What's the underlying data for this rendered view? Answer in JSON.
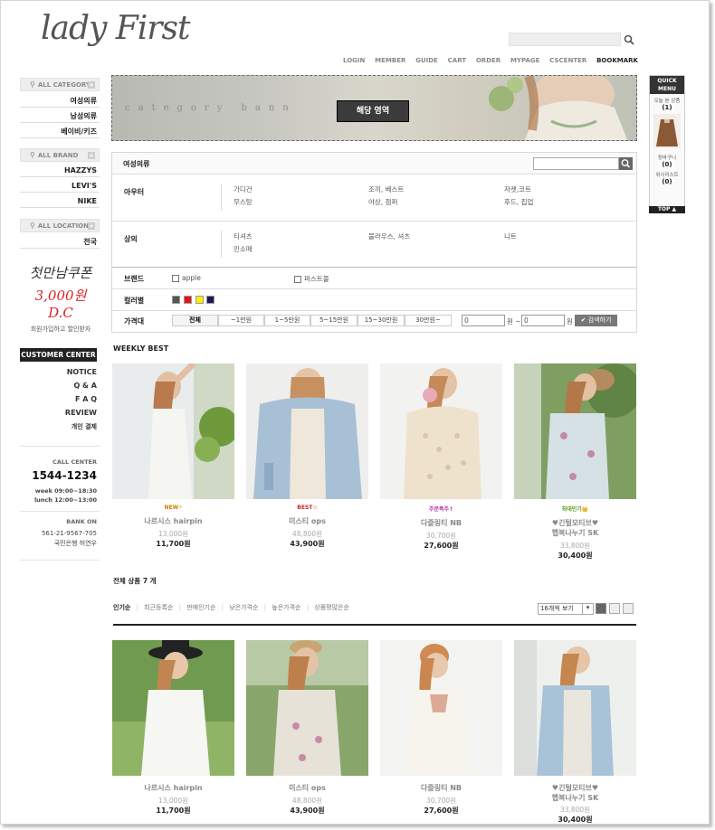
{
  "header": {
    "logo": "lady First",
    "nav": [
      "LOGIN",
      "MEMBER",
      "GUIDE",
      "CART",
      "ORDER",
      "MYPAGE",
      "CSCENTER",
      "BOOKMARK"
    ]
  },
  "sidebar": {
    "category_head": "ALL CATEGORY",
    "categories": [
      "여성의류",
      "남성의류",
      "베이비/키즈"
    ],
    "brand_head": "ALL BRAND",
    "brands": [
      "HAZZYS",
      "LEVI'S",
      "NIKE"
    ],
    "location_head": "ALL LOCATION",
    "locations": [
      "전국"
    ],
    "coupon": {
      "line1": "첫만남쿠폰",
      "line2": "3,000원 D.C",
      "line3": "회원가입하고 할인받자"
    },
    "customer_center": "CUSTOMER CENTER",
    "cs_links": [
      "NOTICE",
      "Q & A",
      "F A Q",
      "REVIEW",
      "개인 결제"
    ],
    "call_center_label": "CALL CENTER",
    "phone": "1544-1234",
    "hours_week": "week 09:00~18:30",
    "hours_lunch": "lunch 12:00~13:00",
    "bank_label": "BANK ON",
    "bank_account": "561-21-9567-705",
    "bank_holder": "국민은행 허연우"
  },
  "banner": {
    "watermark": "category bann",
    "label": "해당 영역"
  },
  "quick_menu": {
    "title_1": "QUICK",
    "title_2": "MENU",
    "recent_label": "오늘 본 상품",
    "recent_count": "(1)",
    "cart_label": "장바구니",
    "cart_count": "(0)",
    "wish_label": "위시리스트",
    "wish_count": "(0)",
    "top": "TOP ▲"
  },
  "filter": {
    "title": "여성의류",
    "outer_label": "아우터",
    "outer_items": [
      "가디건",
      "조끼, 베스트",
      "자켓,코트",
      "무스탕",
      "야상, 점퍼",
      "후드, 집업"
    ],
    "top_label": "상의",
    "top_items": [
      "티셔츠",
      "블라우스, 셔츠",
      "니트",
      "민소매"
    ],
    "brand_label": "브랜드",
    "brand_opts": [
      "apple",
      "퍼스트몰"
    ],
    "color_label": "컬러별",
    "colors": [
      "#555555",
      "#ee1111",
      "#ffee00",
      "#1a1a55"
    ],
    "price_label": "가격대",
    "price_tabs": [
      "전체",
      "~1만원",
      "1~5만원",
      "5~15만원",
      "15~30만원",
      "30만원~"
    ],
    "price_from": "0",
    "price_to": "0",
    "won": "원 ~",
    "won2": "원",
    "search_btn": "✔ 검색하기"
  },
  "weekly_best": {
    "title": "WEEKLY BEST",
    "items": [
      {
        "badge": "NEW⚡",
        "name": "나르시스 hairpin",
        "old": "13,000원",
        "price": "11,700원"
      },
      {
        "badge": "BEST☆",
        "name": "미스티 ops",
        "old": "48,800원",
        "price": "43,900원"
      },
      {
        "badge": "주문폭주↑",
        "name": "다즐링티 NB",
        "old": "30,700원",
        "price": "27,600원"
      },
      {
        "badge": "최대인기👑",
        "name": "♥긴털모티브♥",
        "name2": "햅복나누기 SK",
        "old": "33,800원",
        "price": "30,400원"
      }
    ]
  },
  "list": {
    "total": "전체 상품 7 개",
    "sorts": [
      "인기순",
      "최근등록순",
      "판매인기순",
      "낮은가격순",
      "높은가격순",
      "상품평많은순"
    ],
    "per_page": "16개씩 보기",
    "items": [
      {
        "name": "나르시스 hairpin",
        "old": "13,000원",
        "price": "11,700원"
      },
      {
        "name": "미스티 ops",
        "old": "48,800원",
        "price": "43,900원"
      },
      {
        "name": "다즐링티 NB",
        "old": "30,700원",
        "price": "27,600원"
      },
      {
        "name": "♥긴털모티브♥",
        "name2": "햅복나누기 SK",
        "old": "33,800원",
        "price": "30,400원"
      }
    ]
  }
}
